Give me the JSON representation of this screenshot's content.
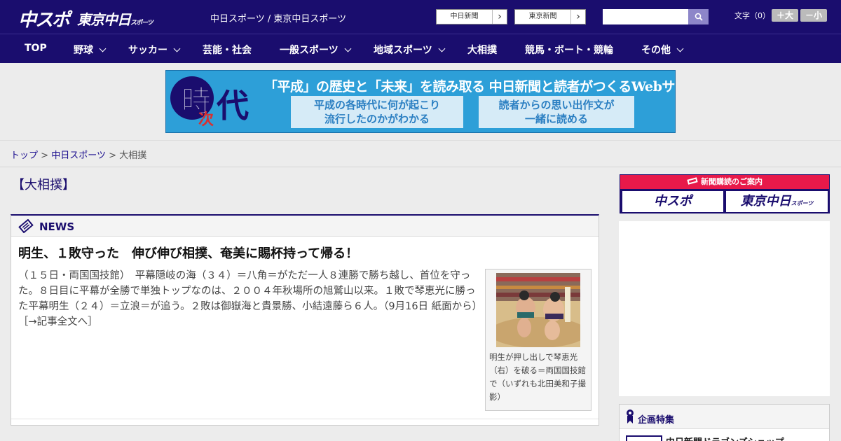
{
  "header": {
    "logo_primary": "中スポ",
    "logo_secondary": "東京中日",
    "logo_secondary_small": "スポーツ",
    "site_title": "中日スポーツ / 東京中日スポーツ",
    "ext_links": [
      {
        "label": "中日新聞"
      },
      {
        "label": "東京新聞"
      }
    ],
    "search_placeholder": "",
    "font_size_label": "文字（0）",
    "font_larger": "＋大",
    "font_smaller": "－小",
    "colors": {
      "brand": "#1a0d6e",
      "accent": "#e8194a"
    }
  },
  "nav": {
    "items": [
      {
        "label": "TOP",
        "dropdown": false
      },
      {
        "label": "野球",
        "dropdown": true
      },
      {
        "label": "サッカー",
        "dropdown": true
      },
      {
        "label": "芸能・社会",
        "dropdown": false
      },
      {
        "label": "一般スポーツ",
        "dropdown": true
      },
      {
        "label": "地域スポーツ",
        "dropdown": true
      },
      {
        "label": "大相撲",
        "dropdown": false
      },
      {
        "label": "競馬・ボート・競輪",
        "dropdown": false
      },
      {
        "label": "その他",
        "dropdown": true
      }
    ]
  },
  "banner": {
    "kanji": [
      "時",
      "次",
      "代"
    ],
    "headline": "「平成」の歴史と「未来」を読み取る 中日新聞と読者がつくるWebサイト",
    "boxes": [
      {
        "line1": "平成の各時代に何が起こり",
        "line2": "流行したのかがわかる"
      },
      {
        "line1": "読者からの思い出作文が",
        "line2": "一緒に読める"
      }
    ]
  },
  "breadcrumb": {
    "items": [
      {
        "label": "トップ",
        "link": true
      },
      {
        "label": "中日スポーツ",
        "link": true
      },
      {
        "label": "大相撲",
        "link": false
      }
    ],
    "separator": ">"
  },
  "main": {
    "category_title": "【大相撲】",
    "news": {
      "section_label": "NEWS",
      "article_title": "明生、１敗守った　伸び伸び相撲、奄美に賜杯持って帰る！",
      "article_body": "（１５日・両国国技館）　平幕隠岐の海（３４）＝八角＝がただ一人８連勝で勝ち越し、首位を守った。８日目に平幕が全勝で単独トップなのは、２００４年秋場所の旭鷲山以来。１敗で琴恵光に勝った平幕明生（２４）＝立浪＝が追う。２敗は御嶽海と貴景勝、小結遠藤ら６人。（9月16日 紙面から）",
      "read_more": "［→記事全文へ］",
      "photo_caption": "明生が押し出しで琴恵光（右）を破る＝両国国技館で（いずれも北田美和子撮影）"
    }
  },
  "sidebar": {
    "subscribe_header": "新聞購読のご案内",
    "subscribe_buttons": [
      {
        "label": "中スポ"
      },
      {
        "label": "東京中日"
      }
    ],
    "subscribe_small": "スポーツ",
    "feature_title": "企画特集",
    "feature_item": "中日新聞ドラゴンズショップ"
  }
}
